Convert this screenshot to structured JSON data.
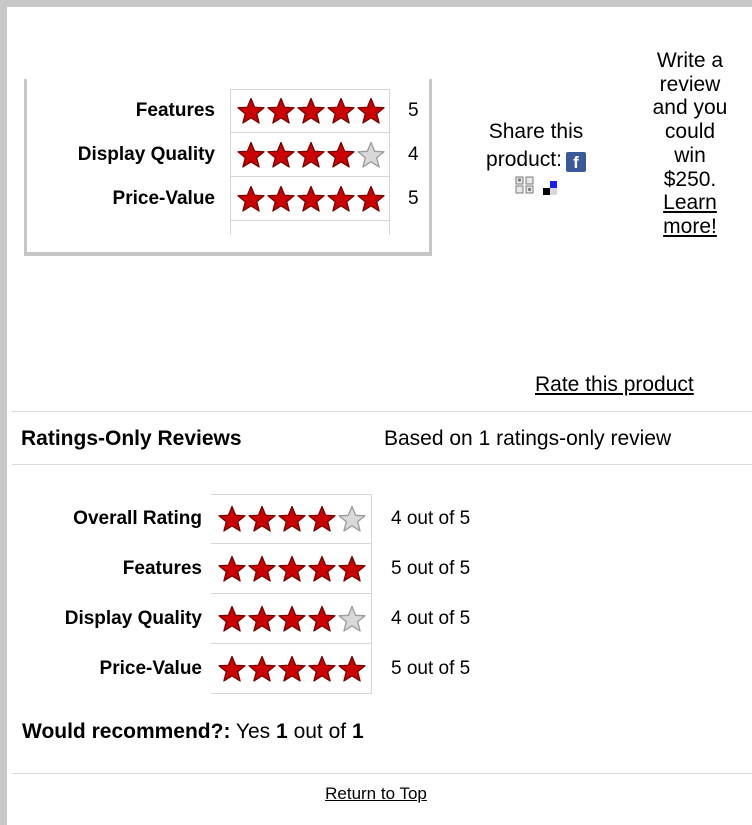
{
  "colors": {
    "star_filled": "#cc0000",
    "star_empty": "#d8d8d8",
    "facebook": "#3b5998",
    "frame": "#c8c8c8"
  },
  "top_ratings": [
    {
      "label": "Features",
      "stars": 5,
      "value": "5"
    },
    {
      "label": "Display Quality",
      "stars": 4,
      "value": "4"
    },
    {
      "label": "Price-Value",
      "stars": 5,
      "value": "5"
    }
  ],
  "share": {
    "line1": "Share this",
    "line2": "product:",
    "icons": [
      "facebook-icon",
      "social-network-icon",
      "delicious-icon"
    ]
  },
  "promo": {
    "text_lines": [
      "Write a",
      "review",
      "and you",
      "could",
      "win",
      "$250."
    ],
    "link_lines": [
      "Learn",
      "more!"
    ]
  },
  "rate_link": "Rate this product",
  "ratings_only": {
    "title": "Ratings-Only Reviews",
    "based_on": "Based on 1 ratings-only review",
    "rows": [
      {
        "label": "Overall Rating",
        "stars": 4,
        "value": "4 out of 5"
      },
      {
        "label": "Features",
        "stars": 5,
        "value": "5 out of 5"
      },
      {
        "label": "Display Quality",
        "stars": 4,
        "value": "4 out of 5"
      },
      {
        "label": "Price-Value",
        "stars": 5,
        "value": "5 out of 5"
      }
    ]
  },
  "recommend": {
    "label": "Would recommend?:",
    "answer": "Yes",
    "count": "1",
    "out_of_text": "out of",
    "total": "1"
  },
  "return_link": "Return to Top"
}
